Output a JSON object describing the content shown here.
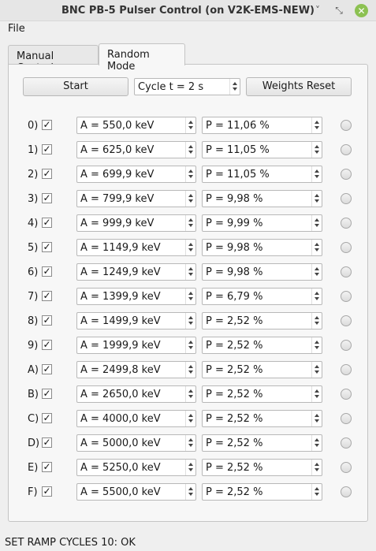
{
  "window": {
    "title": "BNC PB-5 Pulser Control (on V2K-EMS-NEW)",
    "minimize_glyph": "˅",
    "restore_glyph": "⤡",
    "close_glyph": "✕"
  },
  "menu": {
    "file": "File"
  },
  "tabs": [
    {
      "label": "Manual Control",
      "active": false
    },
    {
      "label": "Random Mode",
      "active": true
    }
  ],
  "controls": {
    "start_label": "Start",
    "cycle_value": "Cycle t = 2 s",
    "weights_reset_label": "Weights Reset"
  },
  "channels": [
    {
      "index": "0)",
      "checked": true,
      "amplitude": "A = 550,0 keV",
      "probability": "P = 11,06 %"
    },
    {
      "index": "1)",
      "checked": true,
      "amplitude": "A = 625,0 keV",
      "probability": "P = 11,05 %"
    },
    {
      "index": "2)",
      "checked": true,
      "amplitude": "A = 699,9 keV",
      "probability": "P = 11,05 %"
    },
    {
      "index": "3)",
      "checked": true,
      "amplitude": "A = 799,9 keV",
      "probability": "P = 9,98 %"
    },
    {
      "index": "4)",
      "checked": true,
      "amplitude": "A = 999,9 keV",
      "probability": "P = 9,99 %"
    },
    {
      "index": "5)",
      "checked": true,
      "amplitude": "A = 1149,9 keV",
      "probability": "P = 9,98 %"
    },
    {
      "index": "6)",
      "checked": true,
      "amplitude": "A = 1249,9 keV",
      "probability": "P = 9,98 %"
    },
    {
      "index": "7)",
      "checked": true,
      "amplitude": "A = 1399,9 keV",
      "probability": "P = 6,79 %"
    },
    {
      "index": "8)",
      "checked": true,
      "amplitude": "A = 1499,9 keV",
      "probability": "P = 2,52 %"
    },
    {
      "index": "9)",
      "checked": true,
      "amplitude": "A = 1999,9 keV",
      "probability": "P = 2,52 %"
    },
    {
      "index": "A)",
      "checked": true,
      "amplitude": "A = 2499,8 keV",
      "probability": "P = 2,52 %"
    },
    {
      "index": "B)",
      "checked": true,
      "amplitude": "A = 2650,0 keV",
      "probability": "P = 2,52 %"
    },
    {
      "index": "C)",
      "checked": true,
      "amplitude": "A = 4000,0 keV",
      "probability": "P = 2,52 %"
    },
    {
      "index": "D)",
      "checked": true,
      "amplitude": "A = 5000,0 keV",
      "probability": "P = 2,52 %"
    },
    {
      "index": "E)",
      "checked": true,
      "amplitude": "A = 5250,0 keV",
      "probability": "P = 2,52 %"
    },
    {
      "index": "F)",
      "checked": true,
      "amplitude": "A = 5500,0 keV",
      "probability": "P = 2,52 %"
    }
  ],
  "status": {
    "text": "SET RAMP CYCLES 10: OK"
  },
  "colors": {
    "close_button": "#8cc152",
    "panel": "#f7f7f7",
    "window_bg": "#efefef"
  },
  "icons": {
    "check": "✓"
  }
}
